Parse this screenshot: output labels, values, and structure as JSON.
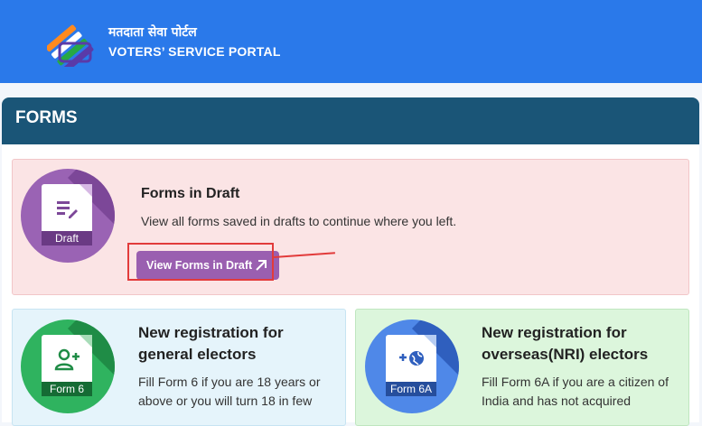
{
  "header": {
    "title_hindi": "मतदाता सेवा पोर्टल",
    "title_english": "VOTERS’ SERVICE PORTAL"
  },
  "section": {
    "title": "FORMS"
  },
  "draft_card": {
    "icon_label": "Draft",
    "heading": "Forms in Draft",
    "description": "View all forms saved in drafts to continue where you left.",
    "button_label": "View Forms in Draft"
  },
  "form6_card": {
    "icon_label": "Form 6",
    "heading_line1": "New registration for",
    "heading_line2": "general electors",
    "description_line1": "Fill Form 6 if you are 18 years or",
    "description_line2": "above or you will turn 18 in few"
  },
  "form6a_card": {
    "icon_label": "Form 6A",
    "heading_line1": "New registration for",
    "heading_line2": "overseas(NRI) electors",
    "description_line1": "Fill Form 6A if you are a citizen of",
    "description_line2": "India and has not acquired"
  },
  "colors": {
    "header_bg": "#2a79ea",
    "section_header_bg": "#1a5577",
    "draft_accent": "#9a5fb0",
    "form6_accent": "#2fb35f",
    "form6a_accent": "#4f88e8",
    "annotation": "#e23b3b"
  }
}
